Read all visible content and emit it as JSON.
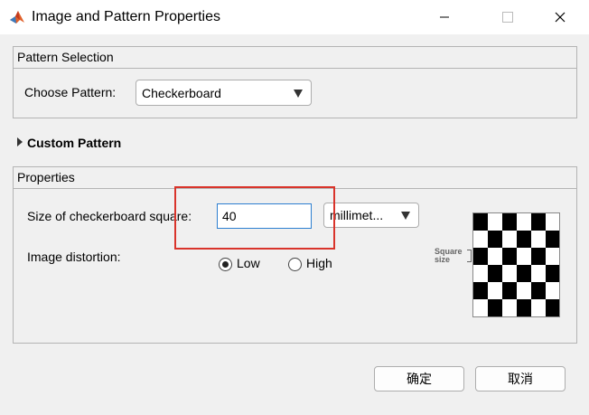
{
  "window": {
    "title": "Image and Pattern Properties"
  },
  "pattern_selection": {
    "header": "Pattern Selection",
    "choose_label": "Choose Pattern:",
    "selected": "Checkerboard"
  },
  "custom_pattern": {
    "label": "Custom Pattern"
  },
  "properties": {
    "header": "Properties",
    "size_label": "Size of checkerboard square:",
    "size_value": "40",
    "units_selected": "millimet...",
    "distortion_label": "Image distortion:",
    "radio_low": "Low",
    "radio_high": "High",
    "selected_distortion": "Low",
    "preview_caption_line1": "Square",
    "preview_caption_line2": "size"
  },
  "footer": {
    "ok_label": "确定",
    "cancel_label": "取消"
  },
  "colors": {
    "highlight": "#d9342b",
    "focus_border": "#2d7fd0"
  }
}
